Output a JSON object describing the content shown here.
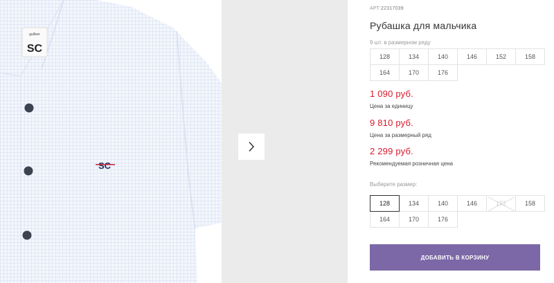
{
  "product": {
    "article_label": "АРТ:",
    "article_value": "22317039",
    "title": "Рубашка для мальчика",
    "logo_text": "SC",
    "tag_text": "gulliver"
  },
  "size_row": {
    "count_text": "9 шт. в размерном ряду",
    "sizes": [
      "128",
      "134",
      "140",
      "146",
      "152",
      "158",
      "164",
      "170",
      "176"
    ]
  },
  "prices": {
    "unit_price": "1 090 руб.",
    "unit_label": "Цена за единицу",
    "row_price": "9 810 руб.",
    "row_label": "Цена за размерный ряд",
    "retail_price": "2 299 руб.",
    "retail_label": "Рекомендуемая розничная цена"
  },
  "size_select": {
    "label": "Выберите размер:",
    "sizes": [
      "128",
      "134",
      "140",
      "146",
      "152",
      "158",
      "164",
      "170",
      "176"
    ],
    "selected": "128",
    "unavailable": "152"
  },
  "cart": {
    "button_label": "ДОБАВИТЬ В КОРЗИНУ"
  },
  "colors": {
    "accent": "#7c68a7",
    "price": "#d7192b",
    "shirt": "#f1f5fb",
    "button_dot": "#3d4250"
  }
}
